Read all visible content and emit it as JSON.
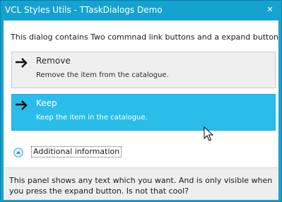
{
  "window": {
    "title": "VCL Styles Utils - TTaskDialogs Demo",
    "close_glyph": "✕",
    "accent_color": "#16a2d0"
  },
  "dialog": {
    "instruction": "This dialog contains Two commnad link buttons and a expand button",
    "command_links": [
      {
        "title": "Remove",
        "description": "Remove the item from the catalogue.",
        "icon": "arrow-right-icon",
        "state": "normal"
      },
      {
        "title": "Keep",
        "description": "Keep the item in the catalogue.",
        "icon": "arrow-right-icon",
        "state": "hover"
      }
    ],
    "expando": {
      "label": "Additional information",
      "icon": "chevron-up-icon",
      "expanded": true
    },
    "footer_text": "This panel shows any text which you want. And is only visible when you press the expand button. Is not that cool?"
  }
}
